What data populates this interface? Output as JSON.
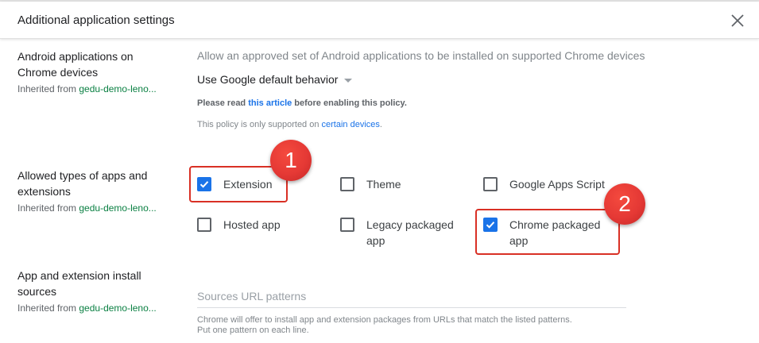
{
  "dialog": {
    "title": "Additional application settings",
    "close_label": "close"
  },
  "android": {
    "title": "Android applications on Chrome devices",
    "inherited_prefix": "Inherited from ",
    "inherited_org": "gedu-demo-leno...",
    "description": "Allow an approved set of Android applications to be installed on supported Chrome devices",
    "dropdown_value": "Use Google default behavior",
    "note1_before": "Please read ",
    "note1_link": "this article",
    "note1_after": " before enabling this policy.",
    "note2_before": "This policy is only supported on ",
    "note2_link": "certain devices",
    "note2_after": "."
  },
  "allowed_types": {
    "title": "Allowed types of apps and extensions",
    "inherited_prefix": "Inherited from ",
    "inherited_org": "gedu-demo-leno...",
    "options": [
      {
        "label": "Extension",
        "checked": true
      },
      {
        "label": "Theme",
        "checked": false
      },
      {
        "label": "Google Apps Script",
        "checked": false
      },
      {
        "label": "Hosted app",
        "checked": false
      },
      {
        "label": "Legacy packaged app",
        "checked": false
      },
      {
        "label": "Chrome packaged app",
        "checked": true
      }
    ]
  },
  "install_sources": {
    "title": "App and extension install sources",
    "inherited_prefix": "Inherited from ",
    "inherited_org": "gedu-demo-leno...",
    "placeholder": "Sources URL patterns",
    "help": "Chrome will offer to install app and extension packages from URLs that match the listed patterns. Put one pattern on each line."
  },
  "annotations": {
    "marker1": "1",
    "marker2": "2",
    "color": "#e53935"
  },
  "colors": {
    "checkbox_checked": "#1a73e8",
    "link": "#1a73e8",
    "inherited_link": "#0b8043"
  }
}
